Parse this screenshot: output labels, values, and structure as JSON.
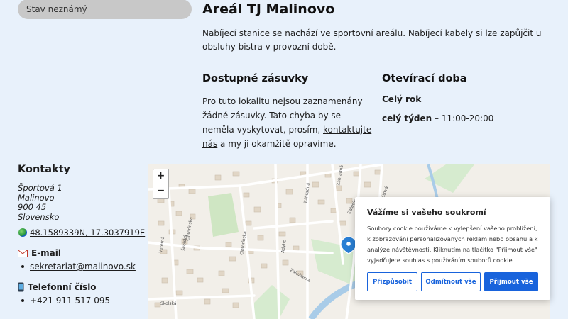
{
  "status": {
    "label": "Stav neznámý"
  },
  "header": {
    "title": "Areál TJ Malinovo"
  },
  "intro": "Nabíjecí stanice se nachází ve sportovní areálu. Nabíjecí kabely si lze zapůjčit u obsluhy bistra v provozní době.",
  "sockets": {
    "heading": "Dostupné zásuvky",
    "text_before": "Pro tuto lokalitu nejsou zaznamenány žádné zásuvky. Tato chyba by se neměla vyskytovat, prosím, ",
    "link": "kontaktujte nás",
    "text_after": " a my ji okamžitě opravíme."
  },
  "hours": {
    "heading": "Otevírací doba",
    "period": "Celý rok",
    "day_label": "celý týden",
    "separator": " – ",
    "time": "11:00-20:00"
  },
  "contacts": {
    "heading": "Kontakty",
    "address": [
      "Športová 1",
      "Malinovo",
      "900 45",
      "Slovensko"
    ],
    "coordinates": "48.1589339N, 17.3037919E",
    "email_heading": "E-mail",
    "email": "sekretariat@malinovo.sk",
    "phone_heading": "Telefonní číslo",
    "phone": "+421 911 517 095"
  },
  "map": {
    "zoom_in": "+",
    "zoom_out": "−",
    "streets": [
      "Cintorínska",
      "Cintorínska",
      "Školská",
      "Školská",
      "Veterná",
      "Adyho",
      "Záhradná",
      "Agátová",
      "Záhradná",
      "Zálesie",
      "Zalužiacka"
    ]
  },
  "cookie": {
    "title": "Vážíme si vašeho soukromí",
    "text": "Soubory cookie používáme k vylepšení vašeho prohlížení, k zobrazování personalizovaných reklam nebo obsahu a k analýze návštěvnosti. Kliknutím na tlačítko \"Přijmout vše\" vyjadřujete souhlas s používáním souborů cookie.",
    "customize": "Přizpůsobit",
    "reject": "Odmítnout vše",
    "accept": "Přijmout vše"
  },
  "colors": {
    "accent": "#1863dc",
    "page_bg": "#e8f1fb",
    "water": "#9ec6e8"
  }
}
